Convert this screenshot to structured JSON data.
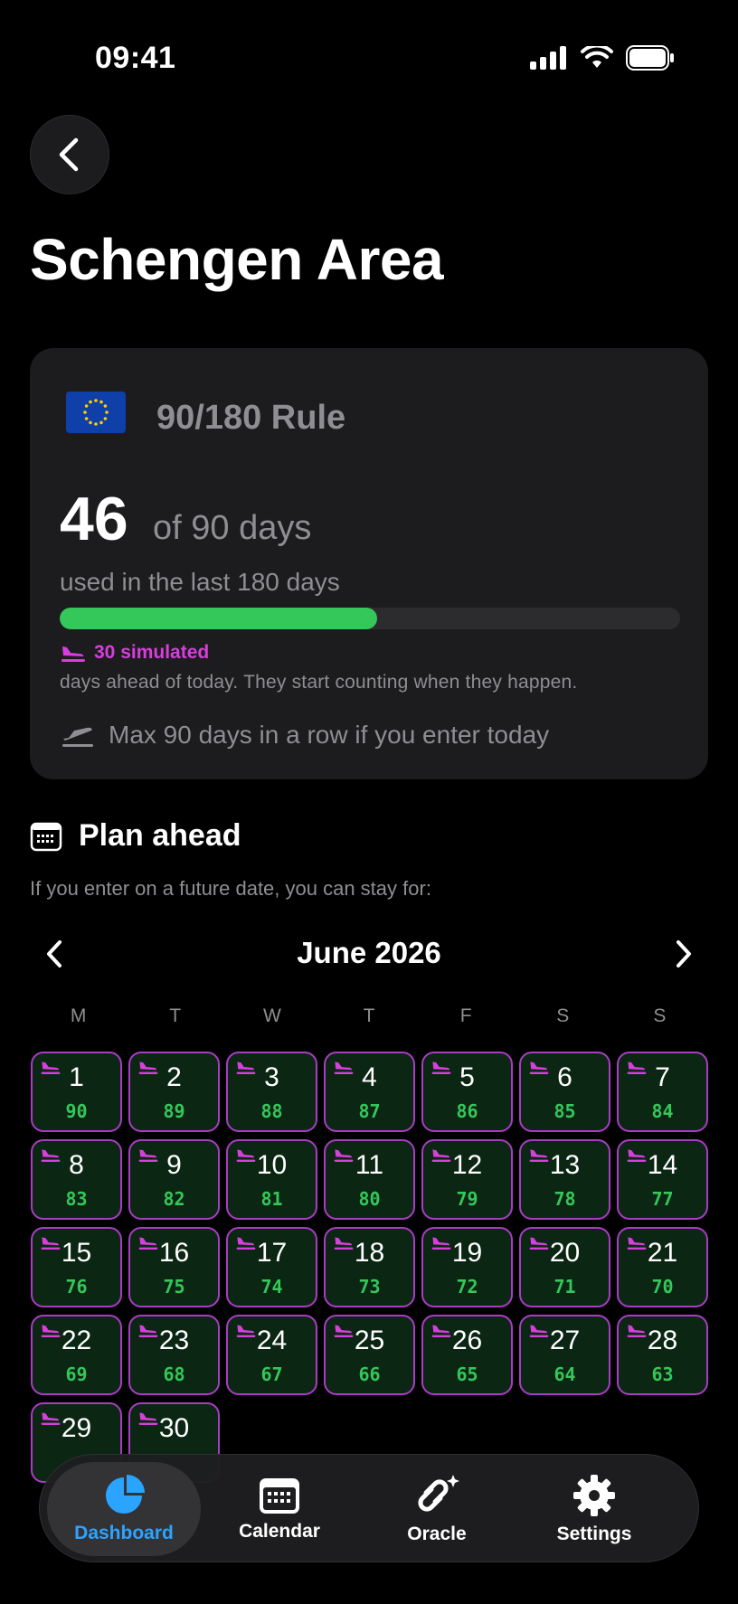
{
  "status_bar": {
    "time": "09:41"
  },
  "header": {
    "title": "Schengen Area"
  },
  "card": {
    "rule_title": "90/180 Rule",
    "days_used": "46",
    "of_days": "of 90 days",
    "used_text": "used in the last 180 days",
    "progress_fraction": 0.511,
    "simulated_label": "30 simulated",
    "simulated_sub": "days ahead of today. They start counting when they happen.",
    "max_text": "Max 90 days in a row if you enter today"
  },
  "plan": {
    "title": "Plan ahead",
    "subtitle": "If you enter on a future date, you can stay for:",
    "month": "June 2026",
    "weekdays": [
      "M",
      "T",
      "W",
      "T",
      "F",
      "S",
      "S"
    ],
    "days": [
      {
        "day": "1",
        "left": "90"
      },
      {
        "day": "2",
        "left": "89"
      },
      {
        "day": "3",
        "left": "88"
      },
      {
        "day": "4",
        "left": "87"
      },
      {
        "day": "5",
        "left": "86"
      },
      {
        "day": "6",
        "left": "85"
      },
      {
        "day": "7",
        "left": "84"
      },
      {
        "day": "8",
        "left": "83"
      },
      {
        "day": "9",
        "left": "82"
      },
      {
        "day": "10",
        "left": "81"
      },
      {
        "day": "11",
        "left": "80"
      },
      {
        "day": "12",
        "left": "79"
      },
      {
        "day": "13",
        "left": "78"
      },
      {
        "day": "14",
        "left": "77"
      },
      {
        "day": "15",
        "left": "76"
      },
      {
        "day": "16",
        "left": "75"
      },
      {
        "day": "17",
        "left": "74"
      },
      {
        "day": "18",
        "left": "73"
      },
      {
        "day": "19",
        "left": "72"
      },
      {
        "day": "20",
        "left": "71"
      },
      {
        "day": "21",
        "left": "70"
      },
      {
        "day": "22",
        "left": "69"
      },
      {
        "day": "23",
        "left": "68"
      },
      {
        "day": "24",
        "left": "67"
      },
      {
        "day": "25",
        "left": "66"
      },
      {
        "day": "26",
        "left": "65"
      },
      {
        "day": "27",
        "left": "64"
      },
      {
        "day": "28",
        "left": "63"
      },
      {
        "day": "29",
        "left": ""
      },
      {
        "day": "30",
        "left": ""
      }
    ]
  },
  "tabs": [
    {
      "label": "Dashboard",
      "icon": "pie-chart-icon",
      "active": true
    },
    {
      "label": "Calendar",
      "icon": "calendar-icon",
      "active": false
    },
    {
      "label": "Oracle",
      "icon": "oracle-sparkle-icon",
      "active": false
    },
    {
      "label": "Settings",
      "icon": "gear-icon",
      "active": false
    }
  ],
  "colors": {
    "accent_blue": "#2aa4ff",
    "green": "#34c759",
    "magenta": "#d63fdc",
    "card_bg": "#1c1c1e"
  }
}
